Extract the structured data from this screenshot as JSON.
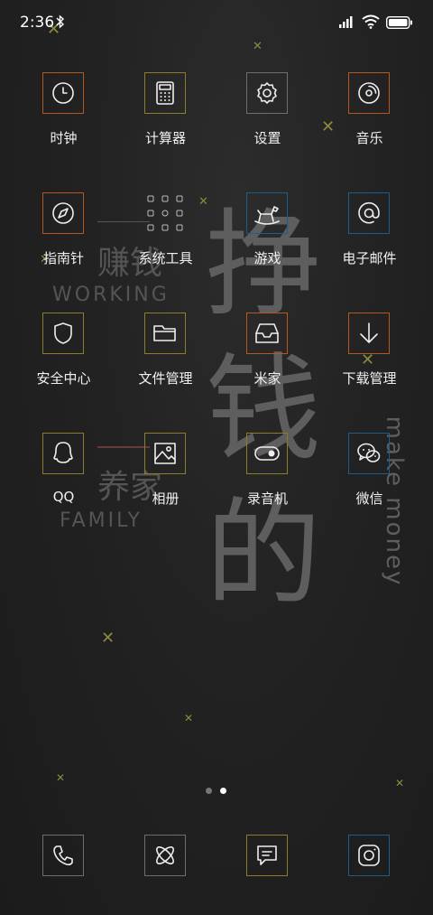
{
  "status_bar": {
    "time": "2:36",
    "icons": [
      "bluetooth-icon",
      "signal-icon",
      "wifi-icon",
      "battery-icon"
    ]
  },
  "colors": {
    "orange": "#b5581e",
    "olive": "#8a7e2a",
    "gray": "#6e6e6e",
    "blue": "#1f5d86",
    "accent_x": "#9a9540"
  },
  "wallpaper": {
    "big_chars": [
      "挣",
      "钱",
      "的"
    ],
    "left_top_cn": "赚钱",
    "left_top_en": "WORKING",
    "left_bottom_cn": "养家",
    "left_bottom_en": "FAMILY",
    "vertical_en": "make money"
  },
  "apps": [
    {
      "label": "时钟",
      "icon": "clock-icon",
      "border": "orange"
    },
    {
      "label": "计算器",
      "icon": "calculator-icon",
      "border": "olive"
    },
    {
      "label": "设置",
      "icon": "gear-icon",
      "border": "gray"
    },
    {
      "label": "音乐",
      "icon": "music-disc-icon",
      "border": "orange"
    },
    {
      "label": "指南针",
      "icon": "compass-icon",
      "border": "orange"
    },
    {
      "label": "系统工具",
      "icon": "tools-grid-icon",
      "border": "none"
    },
    {
      "label": "游戏",
      "icon": "rocking-horse-icon",
      "border": "blue"
    },
    {
      "label": "电子邮件",
      "icon": "at-sign-icon",
      "border": "blue"
    },
    {
      "label": "安全中心",
      "icon": "shield-icon",
      "border": "olive"
    },
    {
      "label": "文件管理",
      "icon": "folder-icon",
      "border": "olive"
    },
    {
      "label": "米家",
      "icon": "inbox-icon",
      "border": "orange"
    },
    {
      "label": "下载管理",
      "icon": "download-arrow-icon",
      "border": "orange"
    },
    {
      "label": "QQ",
      "icon": "qq-penguin-icon",
      "border": "olive"
    },
    {
      "label": "相册",
      "icon": "gallery-icon",
      "border": "olive"
    },
    {
      "label": "录音机",
      "icon": "toggle-switch-icon",
      "border": "olive"
    },
    {
      "label": "微信",
      "icon": "wechat-icon",
      "border": "blue"
    }
  ],
  "pager": {
    "pages": 2,
    "active": 2
  },
  "dock": [
    {
      "icon": "phone-icon",
      "border": "gray"
    },
    {
      "icon": "orbit-browser-icon",
      "border": "gray"
    },
    {
      "icon": "message-icon",
      "border": "olive"
    },
    {
      "icon": "camera-icon",
      "border": "blue"
    }
  ]
}
